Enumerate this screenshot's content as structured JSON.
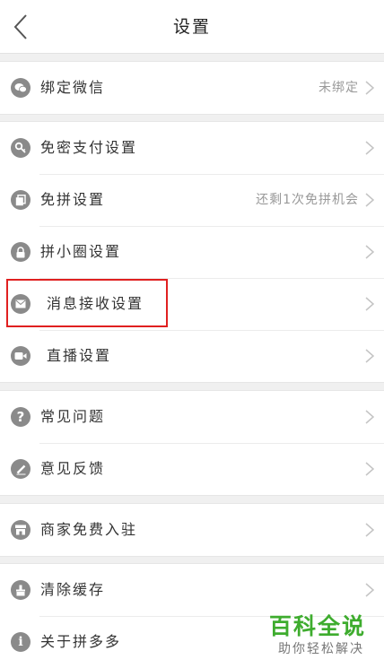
{
  "header": {
    "title": "设置"
  },
  "groups": [
    {
      "items": [
        {
          "label": "绑定微信",
          "value": "未绑定",
          "icon": "wechat-icon"
        }
      ]
    },
    {
      "items": [
        {
          "label": "免密支付设置",
          "icon": "key-icon"
        },
        {
          "label": "免拼设置",
          "value": "还剩1次免拼机会",
          "icon": "copy-icon"
        },
        {
          "label": "拼小圈设置",
          "icon": "lock-icon"
        },
        {
          "label": "消息接收设置",
          "icon": "mail-icon"
        },
        {
          "label": "直播设置",
          "icon": "video-camera-icon"
        }
      ]
    },
    {
      "items": [
        {
          "label": "常见问题",
          "icon": "question-icon"
        },
        {
          "label": "意见反馈",
          "icon": "pencil-icon"
        }
      ]
    },
    {
      "items": [
        {
          "label": "商家免费入驻",
          "icon": "store-icon"
        }
      ]
    },
    {
      "items": [
        {
          "label": "清除缓存",
          "icon": "broom-icon"
        },
        {
          "label": "关于拼多多",
          "icon": "info-icon"
        }
      ]
    }
  ],
  "watermark": {
    "main": "百科全说",
    "sub": "助你轻松解决"
  },
  "colors": {
    "icon": "#8a8a8a",
    "highlight": "#e02020",
    "watermark": "#3eac2e"
  }
}
